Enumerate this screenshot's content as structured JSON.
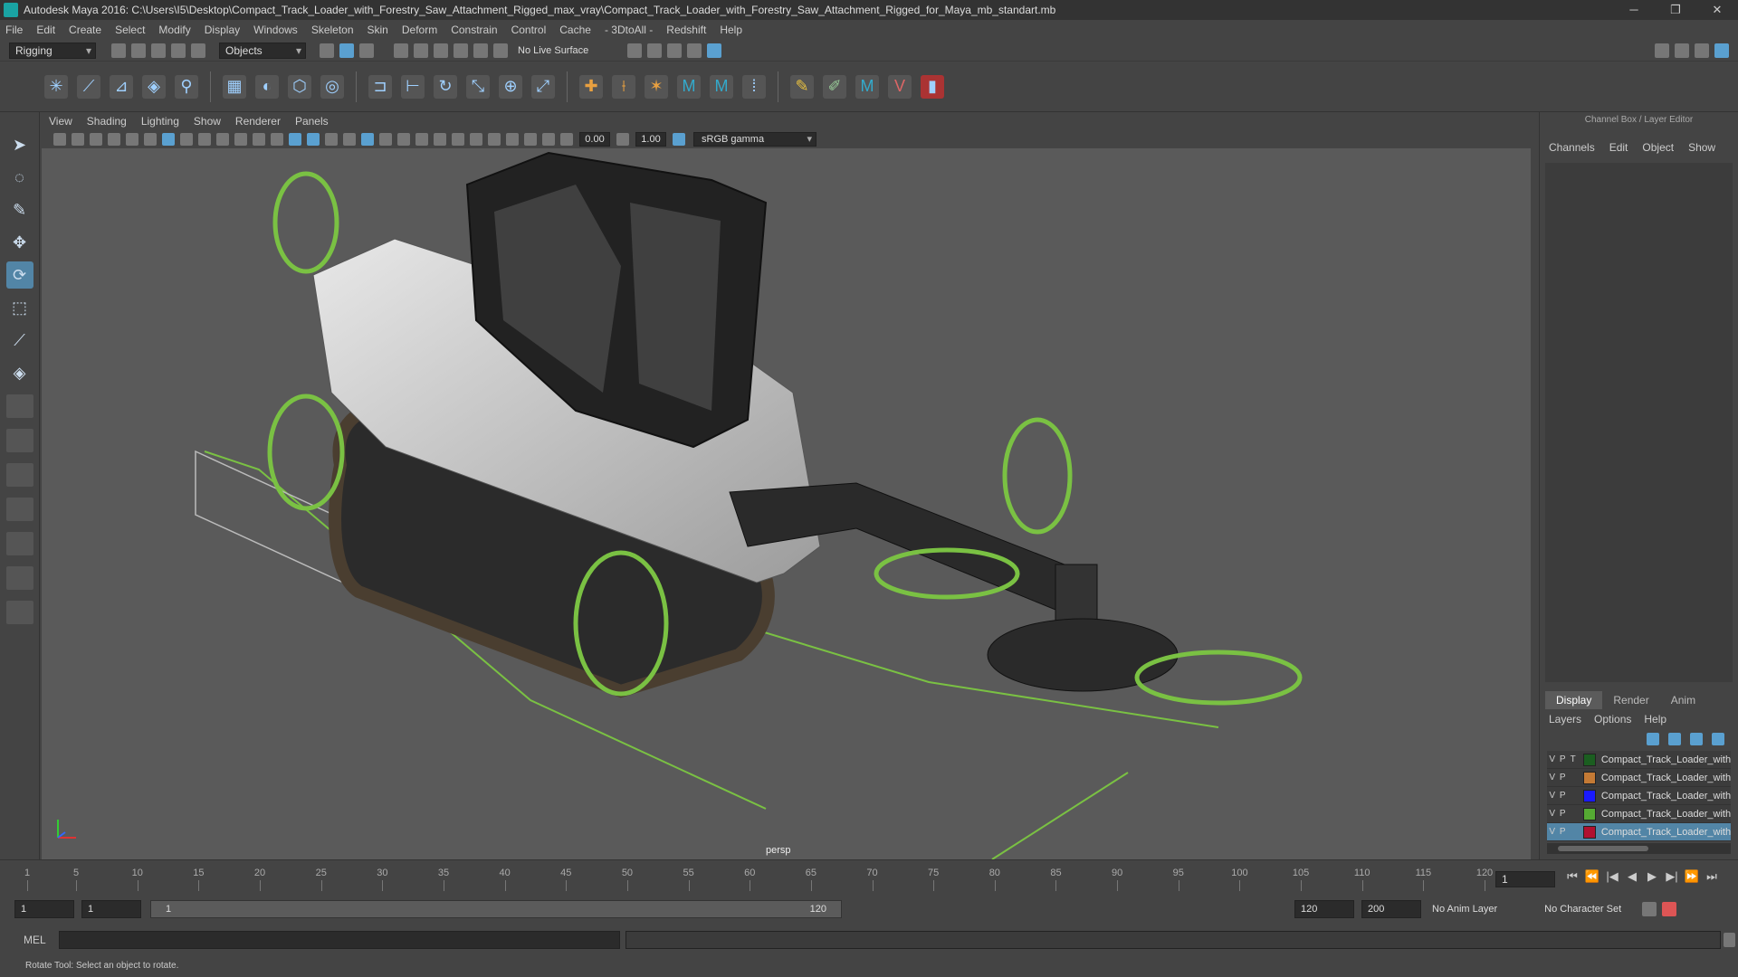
{
  "window": {
    "title": "Autodesk Maya 2016: C:\\Users\\I5\\Desktop\\Compact_Track_Loader_with_Forestry_Saw_Attachment_Rigged_max_vray\\Compact_Track_Loader_with_Forestry_Saw_Attachment_Rigged_for_Maya_mb_standart.mb",
    "minimize": "─",
    "maximize": "❐",
    "close": "✕"
  },
  "menubar": [
    "File",
    "Edit",
    "Create",
    "Select",
    "Modify",
    "Display",
    "Windows",
    "Skeleton",
    "Skin",
    "Deform",
    "Constrain",
    "Control",
    "Cache",
    "- 3DtoAll -",
    "Redshift",
    "Help"
  ],
  "statusline": {
    "mode": "Rigging",
    "selection_mode": "Objects",
    "live_surface": "No Live Surface"
  },
  "viewport": {
    "menu": [
      "View",
      "Shading",
      "Lighting",
      "Show",
      "Renderer",
      "Panels"
    ],
    "exposure": "0.00",
    "gamma_value": "1.00",
    "color_space": "sRGB gamma",
    "camera_label": "persp"
  },
  "channel_box": {
    "title": "Channel Box / Layer Editor",
    "menu": [
      "Channels",
      "Edit",
      "Object",
      "Show"
    ],
    "tabs": [
      "Display",
      "Render",
      "Anim"
    ],
    "layers_menu": [
      "Layers",
      "Options",
      "Help"
    ],
    "layers": [
      {
        "v": "V",
        "p": "P",
        "t": "T",
        "name": "Compact_Track_Loader_with_",
        "color": "#1b5e20"
      },
      {
        "v": "V",
        "p": "P",
        "t": "",
        "name": "Compact_Track_Loader_with_",
        "color": "#c47a35"
      },
      {
        "v": "V",
        "p": "P",
        "t": "",
        "name": "Compact_Track_Loader_with_",
        "color": "#1a1aff"
      },
      {
        "v": "V",
        "p": "P",
        "t": "",
        "name": "Compact_Track_Loader_with_",
        "color": "#55aa33"
      },
      {
        "v": "V",
        "p": "P",
        "t": "",
        "name": "Compact_Track_Loader_with_",
        "color": "#b01030"
      }
    ]
  },
  "timeline": {
    "ticks": [
      "1",
      "5",
      "10",
      "15",
      "20",
      "25",
      "30",
      "35",
      "40",
      "45",
      "50",
      "55",
      "60",
      "65",
      "70",
      "75",
      "80",
      "85",
      "90",
      "95",
      "100",
      "105",
      "110",
      "115",
      "120"
    ],
    "current_frame": "1",
    "playback": [
      "⏮",
      "⏪",
      "|◀",
      "◀",
      "▶",
      "▶|",
      "⏩",
      "⏭"
    ]
  },
  "range": {
    "start": "1",
    "playback_start": "1",
    "slider_start": "1",
    "slider_end": "120",
    "playback_end": "120",
    "end": "200",
    "anim_layer": "No Anim Layer",
    "character_set": "No Character Set"
  },
  "cmdline": {
    "label": "MEL"
  },
  "helpline": {
    "text": "Rotate Tool: Select an object to rotate."
  },
  "colors": {
    "controls": "#7ac143",
    "selected": "#5285a6"
  }
}
